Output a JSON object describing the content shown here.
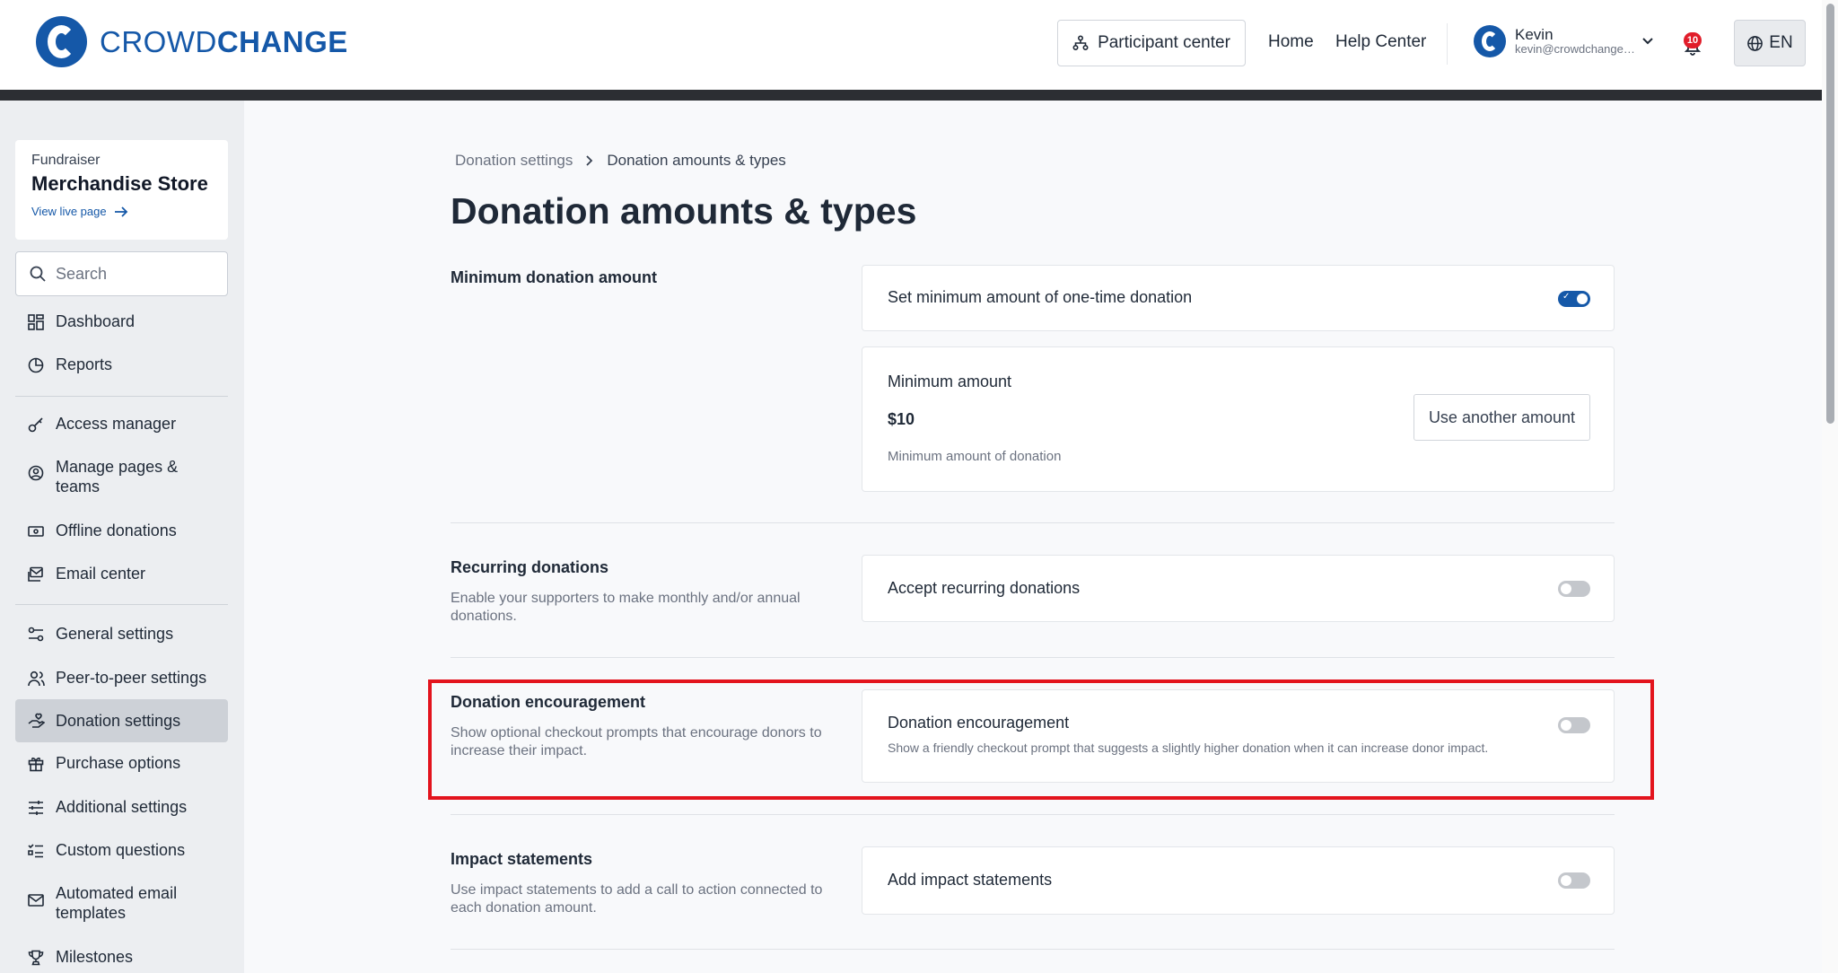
{
  "header": {
    "logo_light": "CROWD",
    "logo_bold": "CHANGE",
    "participant_center": "Participant center",
    "home": "Home",
    "help_center": "Help Center",
    "user_name": "Kevin",
    "user_email": "kevin@crowdchange.co",
    "notification_count": "10",
    "language": "EN",
    "brand_color": "#1558a8"
  },
  "sidebar": {
    "fund_kind": "Fundraiser",
    "fund_name": "Merchandise Store",
    "view_live": "View live page",
    "search_placeholder": "Search",
    "items": [
      {
        "label": "Dashboard",
        "icon": "dashboard-icon"
      },
      {
        "label": "Reports",
        "icon": "pie-chart-icon"
      },
      {
        "label": "Access manager",
        "icon": "key-icon"
      },
      {
        "label": "Manage pages & teams",
        "icon": "user-circle-icon"
      },
      {
        "label": "Offline donations",
        "icon": "cash-icon"
      },
      {
        "label": "Email center",
        "icon": "email-icon"
      },
      {
        "label": "General settings",
        "icon": "sliders-icon"
      },
      {
        "label": "Peer-to-peer settings",
        "icon": "people-icon"
      },
      {
        "label": "Donation settings",
        "icon": "hand-heart-icon",
        "active": true
      },
      {
        "label": "Purchase options",
        "icon": "gift-icon"
      },
      {
        "label": "Additional settings",
        "icon": "adjust-icon"
      },
      {
        "label": "Custom questions",
        "icon": "checklist-icon"
      },
      {
        "label": "Automated email templates",
        "icon": "envelope-icon"
      },
      {
        "label": "Milestones",
        "icon": "trophy-icon"
      }
    ]
  },
  "main": {
    "breadcrumb_parent": "Donation settings",
    "breadcrumb_current": "Donation amounts & types",
    "title": "Donation amounts & types",
    "minimum": {
      "section_title": "Minimum donation amount",
      "toggle_label": "Set minimum amount of one-time donation",
      "toggle_on": true,
      "amount_label": "Minimum amount",
      "amount_value": "$10",
      "amount_help": "Minimum amount of donation",
      "alt_button": "Use another amount"
    },
    "recurring": {
      "section_title": "Recurring donations",
      "section_desc": "Enable your supporters to make monthly and/or annual donations.",
      "toggle_label": "Accept recurring donations",
      "toggle_on": false
    },
    "encouragement": {
      "section_title": "Donation encouragement",
      "section_desc": "Show optional checkout prompts that encourage donors to increase their impact.",
      "toggle_label": "Donation encouragement",
      "toggle_desc": "Show a friendly checkout prompt that suggests a slightly higher donation when it can increase donor impact.",
      "toggle_on": false,
      "highlight_color": "#e3141d"
    },
    "impact": {
      "section_title": "Impact statements",
      "section_desc": "Use impact statements to add a call to action connected to each donation amount.",
      "toggle_label": "Add impact statements",
      "toggle_on": false
    }
  }
}
